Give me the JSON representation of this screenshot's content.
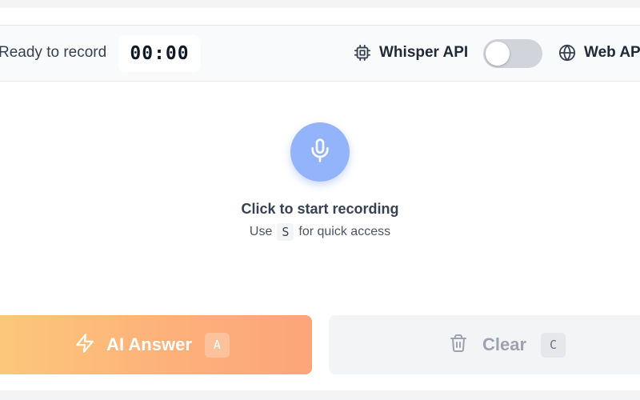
{
  "toolbar": {
    "status": "Ready to record",
    "timer": "00:00",
    "whisper_label": "Whisper API",
    "web_label": "Web API",
    "toggle_on": false
  },
  "recorder": {
    "title": "Click to start recording",
    "hint_prefix": "Use",
    "hint_key": "S",
    "hint_suffix": "for quick access"
  },
  "actions": {
    "ai_answer_label": "AI Answer",
    "ai_answer_key": "A",
    "clear_label": "Clear",
    "clear_key": "C"
  },
  "icons": {
    "whisper": "chip-icon",
    "web": "globe-icon",
    "mic": "microphone-icon",
    "ai": "lightning-icon",
    "clear": "trash-icon"
  },
  "colors": {
    "mic_button": "#93b4fb",
    "ai_gradient_start": "#fcc87b",
    "ai_gradient_end": "#fca57a",
    "toggle_track": "#d1d5db"
  }
}
